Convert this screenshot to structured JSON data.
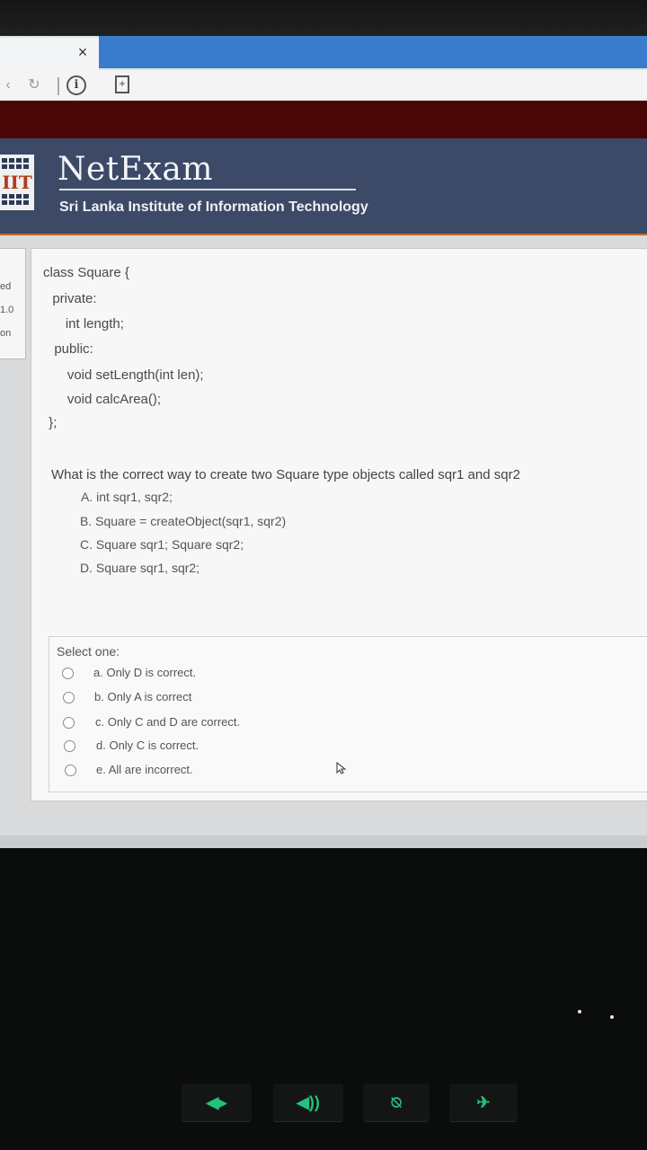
{
  "browser": {
    "tab_close": "×",
    "info_icon": "i",
    "doc_icon": "+"
  },
  "header": {
    "logo_text": "IIT",
    "brand": "NetExam",
    "institute": "Sri Lanka Institute of Information Technology"
  },
  "sidebar": {
    "lines": [
      "ed",
      "1.0",
      "on"
    ]
  },
  "question": {
    "code": [
      "class Square {",
      "  private:",
      "     int length;",
      "  public:",
      "     void setLength(int len);",
      "     void calcArea();",
      " };"
    ],
    "text": "What is the correct way to create two Square type objects called sqr1 and sqr2",
    "choices": [
      "A. int sqr1, sqr2;",
      "B. Square = createObject(sqr1, sqr2)",
      "C. Square sqr1; Square sqr2;",
      "D. Square sqr1, sqr2;"
    ]
  },
  "answer": {
    "prompt": "Select one:",
    "options": [
      "a. Only D is correct.",
      "b. Only A is correct",
      "c. Only C and D are correct.",
      "d. Only C is correct.",
      "e. All are incorrect."
    ]
  },
  "keyboard": {
    "keys": [
      "volume-down-icon",
      "volume-up-icon",
      "mic-mute-icon",
      "airplane-mode-icon"
    ],
    "accent": "#25c07a"
  },
  "colors": {
    "header_bg": "#3c4a68",
    "dark_red_bar": "#4a0506",
    "tab_blue": "#3a7ccc"
  }
}
